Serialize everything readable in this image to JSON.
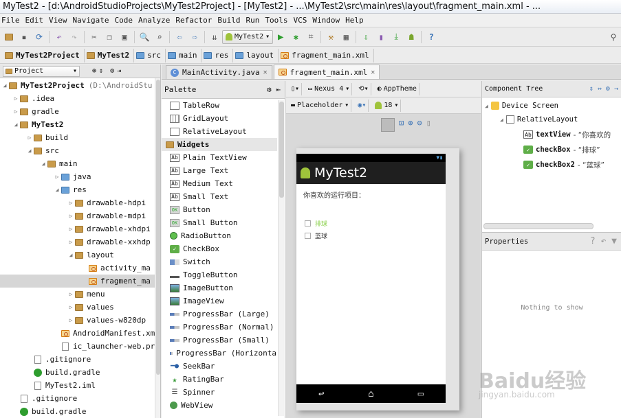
{
  "window": {
    "title": "MyTest2 - [d:\\AndroidStudioProjects\\MyTest2Project] - [MyTest2] - ...\\MyTest2\\src\\main\\res\\layout\\fragment_main.xml - ..."
  },
  "menu": [
    "File",
    "Edit",
    "View",
    "Navigate",
    "Code",
    "Analyze",
    "Refactor",
    "Build",
    "Run",
    "Tools",
    "VCS",
    "Window",
    "Help"
  ],
  "toolbar": {
    "run_config": "MyTest2"
  },
  "breadcrumb": [
    "MyTest2Project",
    "MyTest2",
    "src",
    "main",
    "res",
    "layout",
    "fragment_main.xml"
  ],
  "project_panel": {
    "selector": "Project",
    "items": [
      {
        "label": "MyTest2Project",
        "suffix": "(D:\\AndroidStu",
        "bold": true
      },
      {
        "label": ".idea"
      },
      {
        "label": "gradle"
      },
      {
        "label": "MyTest2",
        "bold": true
      },
      {
        "label": "build"
      },
      {
        "label": "src"
      },
      {
        "label": "main"
      },
      {
        "label": "java"
      },
      {
        "label": "res"
      },
      {
        "label": "drawable-hdpi"
      },
      {
        "label": "drawable-mdpi"
      },
      {
        "label": "drawable-xhdpi"
      },
      {
        "label": "drawable-xxhdp"
      },
      {
        "label": "layout"
      },
      {
        "label": "activity_ma"
      },
      {
        "label": "fragment_ma"
      },
      {
        "label": "menu"
      },
      {
        "label": "values"
      },
      {
        "label": "values-w820dp"
      },
      {
        "label": "AndroidManifest.xm"
      },
      {
        "label": "ic_launcher-web.pr"
      },
      {
        "label": ".gitignore"
      },
      {
        "label": "build.gradle"
      },
      {
        "label": "MyTest2.iml"
      },
      {
        "label": ".gitignore"
      },
      {
        "label": "build.gradle"
      }
    ]
  },
  "tabs": [
    {
      "label": "MainActivity.java",
      "active": false
    },
    {
      "label": "fragment_main.xml",
      "active": true
    }
  ],
  "palette": {
    "title": "Palette",
    "layouts": [
      "TableRow",
      "GridLayout",
      "RelativeLayout"
    ],
    "group": "Widgets",
    "widgets": [
      "Plain TextView",
      "Large Text",
      "Medium Text",
      "Small Text",
      "Button",
      "Small Button",
      "RadioButton",
      "CheckBox",
      "Switch",
      "ToggleButton",
      "ImageButton",
      "ImageView",
      "ProgressBar (Large)",
      "ProgressBar (Normal)",
      "ProgressBar (Small)",
      "ProgressBar (Horizonta",
      "SeekBar",
      "RatingBar",
      "Spinner",
      "WebView"
    ]
  },
  "design_toolbar": {
    "device": "Nexus 4",
    "theme": "AppTheme",
    "locale": "Placeholder",
    "api": "18"
  },
  "preview": {
    "app_title": "MyTest2",
    "prompt": "你喜欢的运行项目：",
    "checkbox1": "排球",
    "checkbox2": "蓝球",
    "accent": "#8ad04a"
  },
  "component_tree": {
    "title": "Component Tree",
    "root": "Device Screen",
    "layout": "RelativeLayout",
    "nodes": [
      {
        "id": "textView",
        "text": "- “你喜欢的"
      },
      {
        "id": "checkBox",
        "text": "- “排球”"
      },
      {
        "id": "checkBox2",
        "text": "- “蓝球”"
      }
    ]
  },
  "properties": {
    "title": "Properties",
    "empty": "Nothing to show"
  },
  "watermark": {
    "brand": "Baidu经验",
    "url": "jingyan.baidu.com"
  }
}
